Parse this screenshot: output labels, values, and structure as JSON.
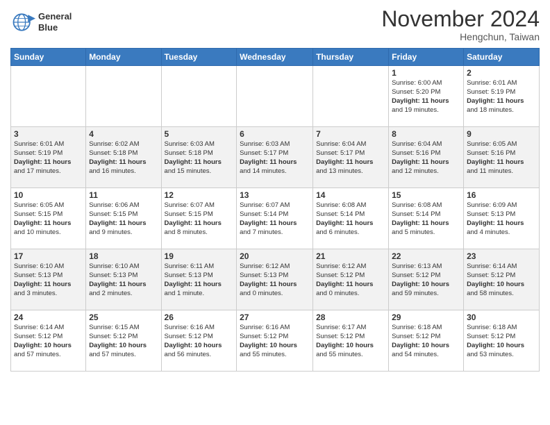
{
  "header": {
    "logo_line1": "General",
    "logo_line2": "Blue",
    "month_title": "November 2024",
    "location": "Hengchun, Taiwan"
  },
  "weekdays": [
    "Sunday",
    "Monday",
    "Tuesday",
    "Wednesday",
    "Thursday",
    "Friday",
    "Saturday"
  ],
  "weeks": [
    [
      {
        "day": "",
        "info": ""
      },
      {
        "day": "",
        "info": ""
      },
      {
        "day": "",
        "info": ""
      },
      {
        "day": "",
        "info": ""
      },
      {
        "day": "",
        "info": ""
      },
      {
        "day": "1",
        "info": "Sunrise: 6:00 AM\nSunset: 5:20 PM\nDaylight: 11 hours\nand 19 minutes."
      },
      {
        "day": "2",
        "info": "Sunrise: 6:01 AM\nSunset: 5:19 PM\nDaylight: 11 hours\nand 18 minutes."
      }
    ],
    [
      {
        "day": "3",
        "info": "Sunrise: 6:01 AM\nSunset: 5:19 PM\nDaylight: 11 hours\nand 17 minutes."
      },
      {
        "day": "4",
        "info": "Sunrise: 6:02 AM\nSunset: 5:18 PM\nDaylight: 11 hours\nand 16 minutes."
      },
      {
        "day": "5",
        "info": "Sunrise: 6:03 AM\nSunset: 5:18 PM\nDaylight: 11 hours\nand 15 minutes."
      },
      {
        "day": "6",
        "info": "Sunrise: 6:03 AM\nSunset: 5:17 PM\nDaylight: 11 hours\nand 14 minutes."
      },
      {
        "day": "7",
        "info": "Sunrise: 6:04 AM\nSunset: 5:17 PM\nDaylight: 11 hours\nand 13 minutes."
      },
      {
        "day": "8",
        "info": "Sunrise: 6:04 AM\nSunset: 5:16 PM\nDaylight: 11 hours\nand 12 minutes."
      },
      {
        "day": "9",
        "info": "Sunrise: 6:05 AM\nSunset: 5:16 PM\nDaylight: 11 hours\nand 11 minutes."
      }
    ],
    [
      {
        "day": "10",
        "info": "Sunrise: 6:05 AM\nSunset: 5:15 PM\nDaylight: 11 hours\nand 10 minutes."
      },
      {
        "day": "11",
        "info": "Sunrise: 6:06 AM\nSunset: 5:15 PM\nDaylight: 11 hours\nand 9 minutes."
      },
      {
        "day": "12",
        "info": "Sunrise: 6:07 AM\nSunset: 5:15 PM\nDaylight: 11 hours\nand 8 minutes."
      },
      {
        "day": "13",
        "info": "Sunrise: 6:07 AM\nSunset: 5:14 PM\nDaylight: 11 hours\nand 7 minutes."
      },
      {
        "day": "14",
        "info": "Sunrise: 6:08 AM\nSunset: 5:14 PM\nDaylight: 11 hours\nand 6 minutes."
      },
      {
        "day": "15",
        "info": "Sunrise: 6:08 AM\nSunset: 5:14 PM\nDaylight: 11 hours\nand 5 minutes."
      },
      {
        "day": "16",
        "info": "Sunrise: 6:09 AM\nSunset: 5:13 PM\nDaylight: 11 hours\nand 4 minutes."
      }
    ],
    [
      {
        "day": "17",
        "info": "Sunrise: 6:10 AM\nSunset: 5:13 PM\nDaylight: 11 hours\nand 3 minutes."
      },
      {
        "day": "18",
        "info": "Sunrise: 6:10 AM\nSunset: 5:13 PM\nDaylight: 11 hours\nand 2 minutes."
      },
      {
        "day": "19",
        "info": "Sunrise: 6:11 AM\nSunset: 5:13 PM\nDaylight: 11 hours\nand 1 minute."
      },
      {
        "day": "20",
        "info": "Sunrise: 6:12 AM\nSunset: 5:13 PM\nDaylight: 11 hours\nand 0 minutes."
      },
      {
        "day": "21",
        "info": "Sunrise: 6:12 AM\nSunset: 5:12 PM\nDaylight: 11 hours\nand 0 minutes."
      },
      {
        "day": "22",
        "info": "Sunrise: 6:13 AM\nSunset: 5:12 PM\nDaylight: 10 hours\nand 59 minutes."
      },
      {
        "day": "23",
        "info": "Sunrise: 6:14 AM\nSunset: 5:12 PM\nDaylight: 10 hours\nand 58 minutes."
      }
    ],
    [
      {
        "day": "24",
        "info": "Sunrise: 6:14 AM\nSunset: 5:12 PM\nDaylight: 10 hours\nand 57 minutes."
      },
      {
        "day": "25",
        "info": "Sunrise: 6:15 AM\nSunset: 5:12 PM\nDaylight: 10 hours\nand 57 minutes."
      },
      {
        "day": "26",
        "info": "Sunrise: 6:16 AM\nSunset: 5:12 PM\nDaylight: 10 hours\nand 56 minutes."
      },
      {
        "day": "27",
        "info": "Sunrise: 6:16 AM\nSunset: 5:12 PM\nDaylight: 10 hours\nand 55 minutes."
      },
      {
        "day": "28",
        "info": "Sunrise: 6:17 AM\nSunset: 5:12 PM\nDaylight: 10 hours\nand 55 minutes."
      },
      {
        "day": "29",
        "info": "Sunrise: 6:18 AM\nSunset: 5:12 PM\nDaylight: 10 hours\nand 54 minutes."
      },
      {
        "day": "30",
        "info": "Sunrise: 6:18 AM\nSunset: 5:12 PM\nDaylight: 10 hours\nand 53 minutes."
      }
    ]
  ]
}
